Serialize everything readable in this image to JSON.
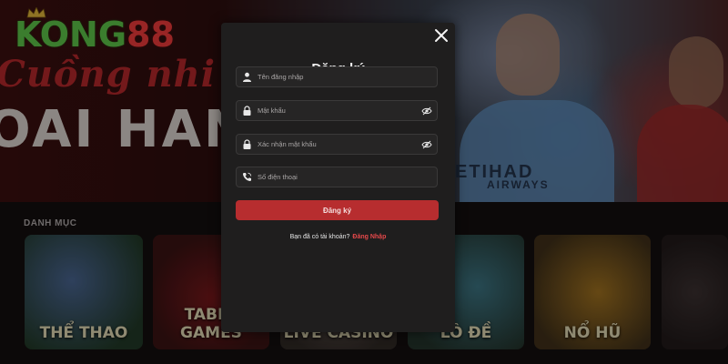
{
  "site": {
    "logo_prefix": "KONG",
    "logo_suffix": "88",
    "banner_script": "Cuồng nhi",
    "banner_headline": "OAI HAN",
    "shirt_sponsor": "ETIHAD",
    "shirt_sponsor_sub": "AIRWAYS"
  },
  "categories": {
    "title": "DANH MỤC",
    "items": [
      {
        "label": "THỂ THAO"
      },
      {
        "label": "TABLE GAMES"
      },
      {
        "label": "LIVE CASINO"
      },
      {
        "label": "LÔ ĐỀ"
      },
      {
        "label": "NỔ HŨ"
      },
      {
        "label": ""
      }
    ]
  },
  "modal": {
    "title": "Đăng ký",
    "fields": {
      "username": {
        "placeholder": "Tên đăng nhập",
        "icon": "user-icon"
      },
      "password": {
        "placeholder": "Mật khẩu",
        "icon": "lock-icon"
      },
      "confirm_password": {
        "placeholder": "Xác nhận mật khẩu",
        "icon": "lock-icon"
      },
      "phone": {
        "placeholder": "Số điện thoại",
        "icon": "phone-icon"
      }
    },
    "submit_label": "Đăng ký",
    "login_prompt": "Bạn đã có tài khoản?",
    "login_link": "Đăng Nhập"
  },
  "colors": {
    "accent": "#b72d2f",
    "link": "#e4484a",
    "modal_bg": "#1f1e1e",
    "logo_green": "#5fd24a",
    "logo_red": "#ff3b3b"
  }
}
